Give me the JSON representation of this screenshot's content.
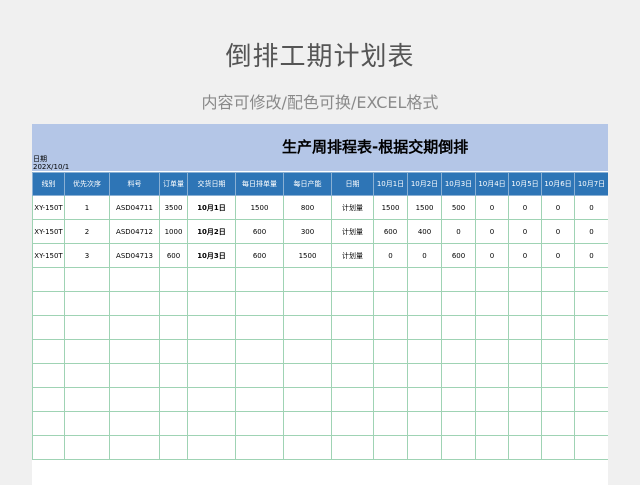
{
  "page": {
    "title": "倒排工期计划表",
    "subtitle": "内容可修改/配色可换/EXCEL格式"
  },
  "sheet": {
    "date_label": "日期",
    "date_value": "202X/10/1",
    "title": "生产周排程表-根据交期倒排",
    "headers": [
      "线别",
      "优先次序",
      "料号",
      "订单量",
      "交货日期",
      "每日排单量",
      "每日产能",
      "日期",
      "10月1日",
      "10月2日",
      "10月3日",
      "10月4日",
      "10月5日",
      "10月6日",
      "10月7日"
    ],
    "rows": [
      [
        "XY-150T",
        "1",
        "ASD04711",
        "3500",
        "10月1日",
        "1500",
        "800",
        "计划量",
        "1500",
        "1500",
        "500",
        "0",
        "0",
        "0",
        "0"
      ],
      [
        "XY-150T",
        "2",
        "ASD04712",
        "1000",
        "10月2日",
        "600",
        "300",
        "计划量",
        "600",
        "400",
        "0",
        "0",
        "0",
        "0",
        "0"
      ],
      [
        "XY-150T",
        "3",
        "ASD04713",
        "600",
        "10月3日",
        "600",
        "1500",
        "计划量",
        "0",
        "0",
        "600",
        "0",
        "0",
        "0",
        "0"
      ]
    ],
    "empty_rows": 8
  },
  "colors": {
    "background": "#f0f0f0",
    "banner": "#b4c6e7",
    "header": "#2e75b6",
    "grid": "#9fd3b4"
  }
}
